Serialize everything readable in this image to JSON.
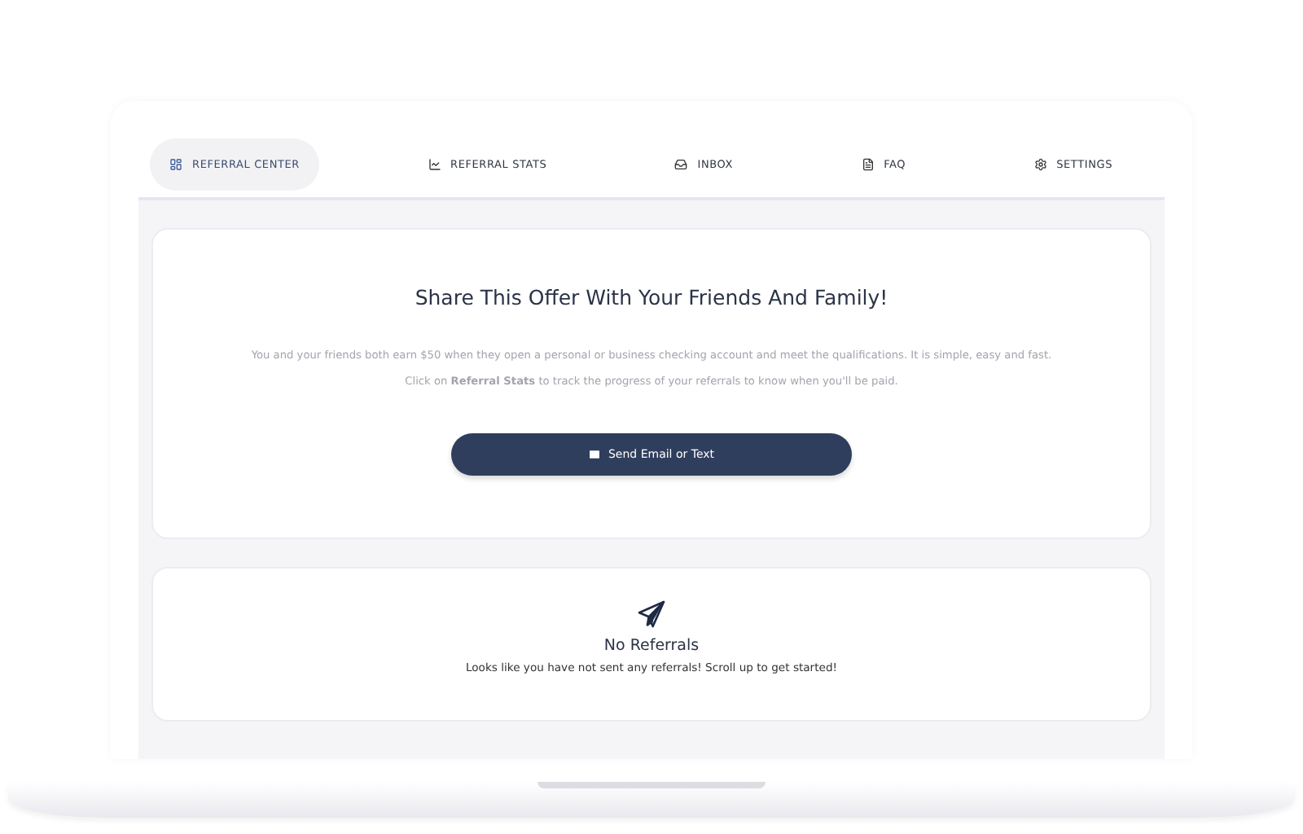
{
  "nav": [
    {
      "label": "REFERRAL CENTER",
      "kind": "grid",
      "selected": true
    },
    {
      "label": "REFERRAL STATS",
      "kind": "chart",
      "selected": false
    },
    {
      "label": "INBOX",
      "kind": "inbox",
      "selected": false
    },
    {
      "label": "FAQ",
      "kind": "file",
      "selected": false
    },
    {
      "label": "SETTINGS",
      "kind": "gear",
      "selected": false
    }
  ],
  "offer": {
    "title": "Share This Offer With Your Friends And Family!",
    "paragraphs": [
      "You and your friends both earn $50 when they open a personal or business checking account and meet the qualifications. It is simple, easy and fast.",
      "Click on **Referral Stats** to track the progress of your referrals to know when you'll be paid."
    ],
    "button": "Send Email or Text"
  },
  "empty_state": {
    "title": "No Referrals",
    "message": "Looks like you have not sent any referrals! Scroll up to get started!"
  }
}
